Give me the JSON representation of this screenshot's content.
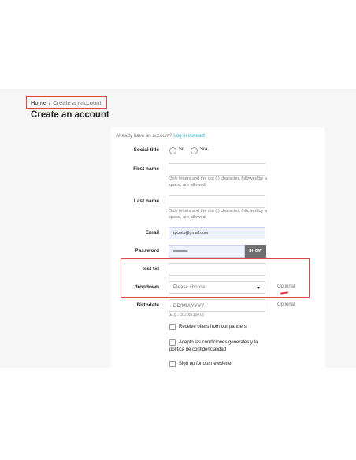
{
  "breadcrumb": {
    "home": "Home",
    "separator": "/",
    "current": "Create an account"
  },
  "page_title": "Create an account",
  "already": {
    "text": "Already have an account?",
    "link": "Log in instead!"
  },
  "social_title": {
    "label": "Social title",
    "options": [
      "Sr.",
      "Sra."
    ]
  },
  "first_name": {
    "label": "First name",
    "value": "",
    "help": "Only letters and the dot (.) character, followed by a space, are allowed."
  },
  "last_name": {
    "label": "Last name",
    "value": "",
    "help": "Only letters and the dot (.) character, followed by a space, are allowed."
  },
  "email": {
    "label": "Email",
    "value": "tpcmtx@gmail.com"
  },
  "password": {
    "label": "Password",
    "value": "••••••••••••••••••••",
    "show_label": "SHOW"
  },
  "test_txt": {
    "label": "test txt",
    "value": ""
  },
  "dropdown": {
    "label": "dropdown",
    "selected": "Please choose",
    "optional": "Optional"
  },
  "birthdate": {
    "label": "Birthdate",
    "placeholder": "DD/MM/YYYY",
    "help": "(E.g.: 31/05/1970)",
    "optional": "Optional"
  },
  "checkboxes": [
    {
      "label": "Receive offers from our partners"
    },
    {
      "label": "Acepto las condiciones generales y la política de confidencialidad"
    },
    {
      "label": "Sign up for our newsletter"
    }
  ],
  "colors": {
    "link": "#2fb5d2",
    "highlight": "#e04848",
    "show_button": "#6e6e6e"
  }
}
